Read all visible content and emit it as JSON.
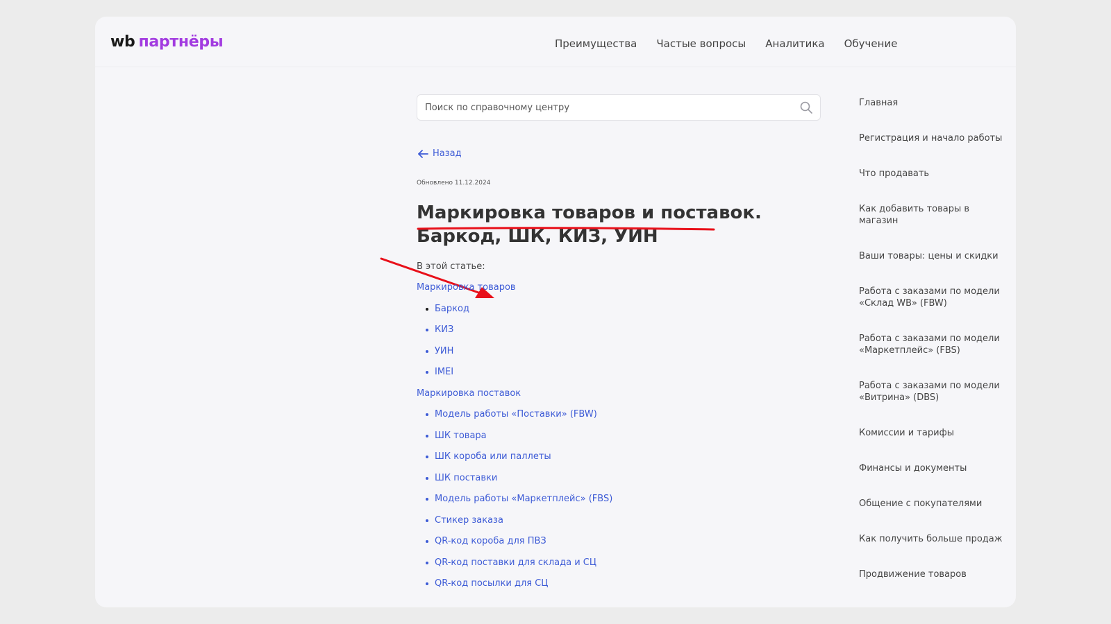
{
  "header": {
    "logo_wb": "wb",
    "logo_partners": "партнёры",
    "nav": [
      "Преимущества",
      "Частые вопросы",
      "Аналитика",
      "Обучение"
    ]
  },
  "search": {
    "placeholder": "Поиск по справочному центру",
    "icon": "search-icon"
  },
  "article": {
    "back_label": "Назад",
    "updated": "Обновлено 11.12.2024",
    "title": "Маркировка товаров и поставок. Баркод, ШК, КИЗ, УИН",
    "toc_intro": "В этой статье:",
    "toc": [
      {
        "label": "Маркировка товаров",
        "children": [
          "Баркод",
          "КИЗ",
          "УИН",
          "IMEI"
        ]
      },
      {
        "label": "Маркировка поставок",
        "children": [
          "Модель работы «Поставки» (FBW)",
          "ШК товара",
          "ШК короба или паллеты",
          "ШК поставки",
          "Модель работы «Маркетплейс» (FBS)",
          "Стикер заказа",
          "QR-код короба для ПВЗ",
          "QR-код поставки для склада и СЦ",
          "QR-код посылки для СЦ"
        ]
      }
    ]
  },
  "sidebar": {
    "items": [
      "Главная",
      "Регистрация и начало работы",
      "Что продавать",
      "Как добавить товары в магазин",
      "Ваши товары: цены и скидки",
      "Работа с заказами по модели «Склад WB» (FBW)",
      "Работа с заказами по модели «Маркетплейс» (FBS)",
      "Работа с заказами по модели «Витрина» (DBS)",
      "Комиссии и тарифы",
      "Финансы и документы",
      "Общение с покупателями",
      "Как получить больше продаж",
      "Продвижение товаров"
    ]
  },
  "colors": {
    "accent_link": "#3d5bd6",
    "brand_purple": "#a23be0",
    "annotation_red": "#e8101a"
  }
}
